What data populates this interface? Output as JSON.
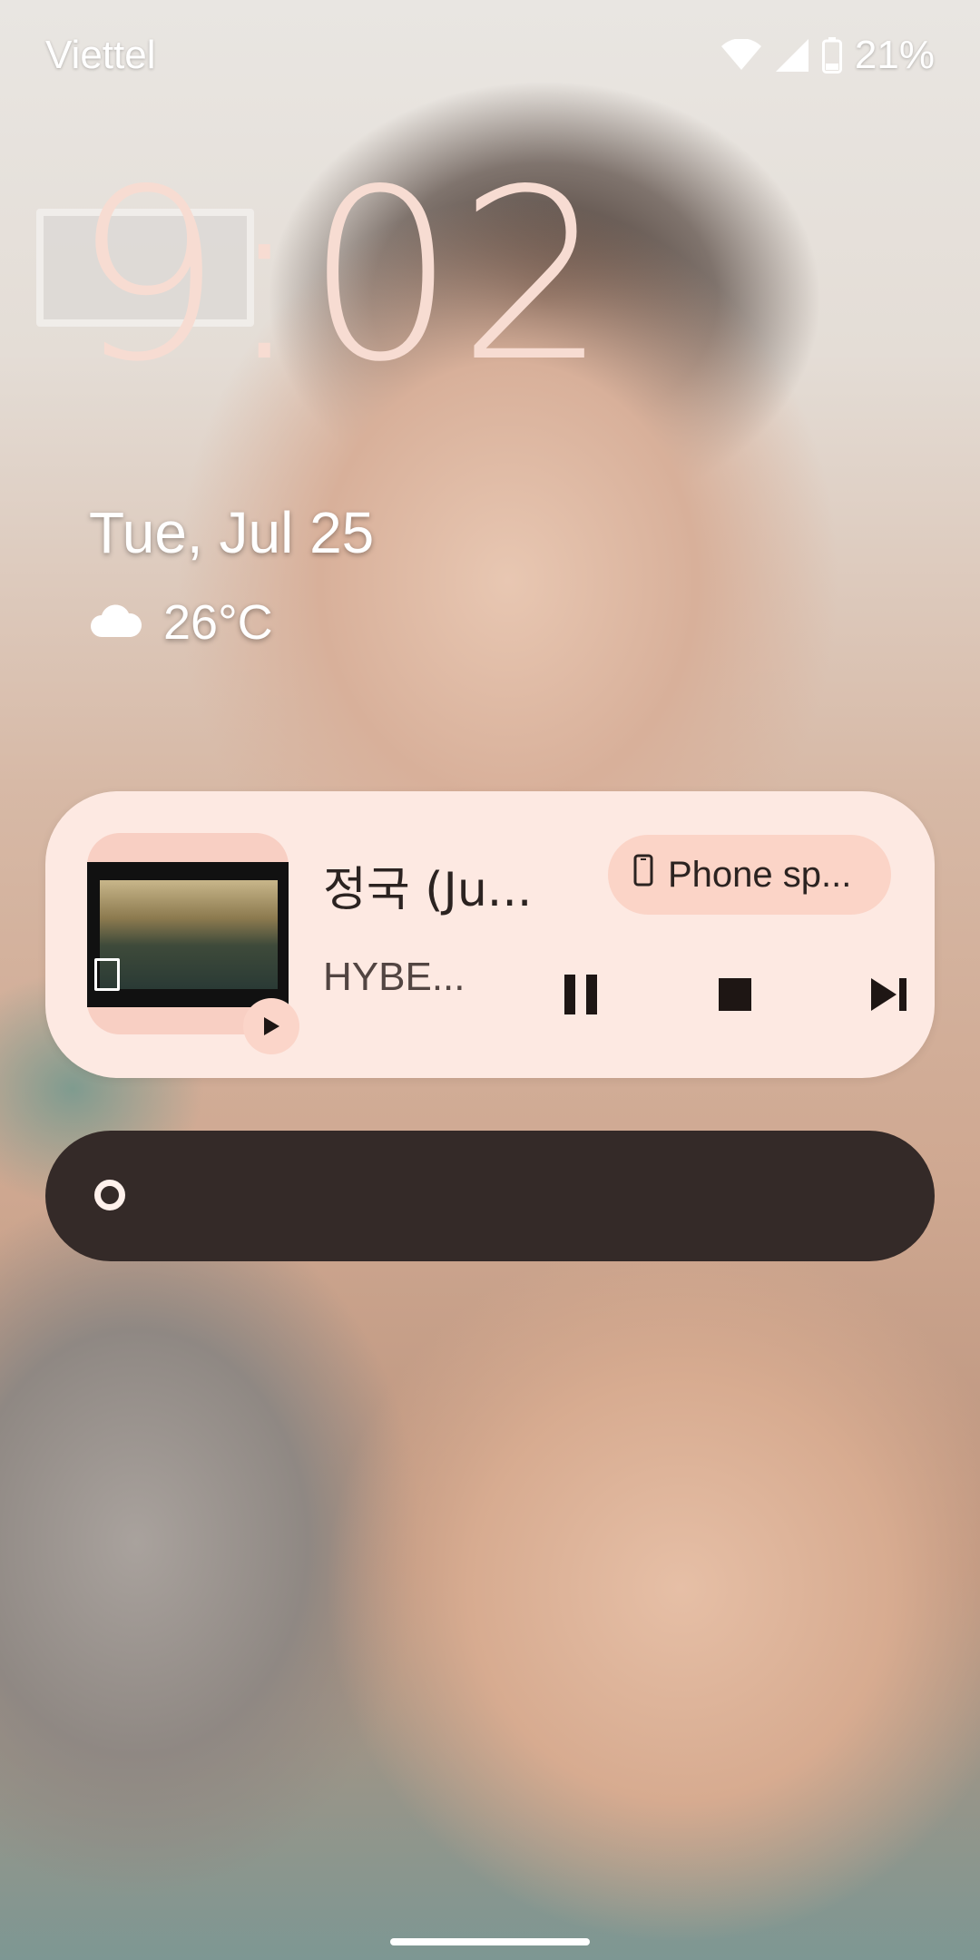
{
  "status_bar": {
    "carrier": "Viettel",
    "battery_percent": "21%",
    "icons": [
      "wifi-icon",
      "cell-signal-icon",
      "battery-icon"
    ]
  },
  "lockscreen": {
    "time": "9:02",
    "date": "Tue, Jul 25",
    "weather": {
      "icon": "cloud-icon",
      "temperature": "26°C"
    }
  },
  "media": {
    "title": "정국 (Ju...",
    "artist": "HYBE...",
    "output_device": "Phone sp...",
    "controls": [
      "pause",
      "stop",
      "skip-next"
    ],
    "colors": {
      "card": "#fde9e2",
      "chip": "#fbd4c7",
      "accent": "#2b2321"
    }
  },
  "colors": {
    "clock": "#f7dcd2",
    "dark_bar": "#342a28"
  }
}
